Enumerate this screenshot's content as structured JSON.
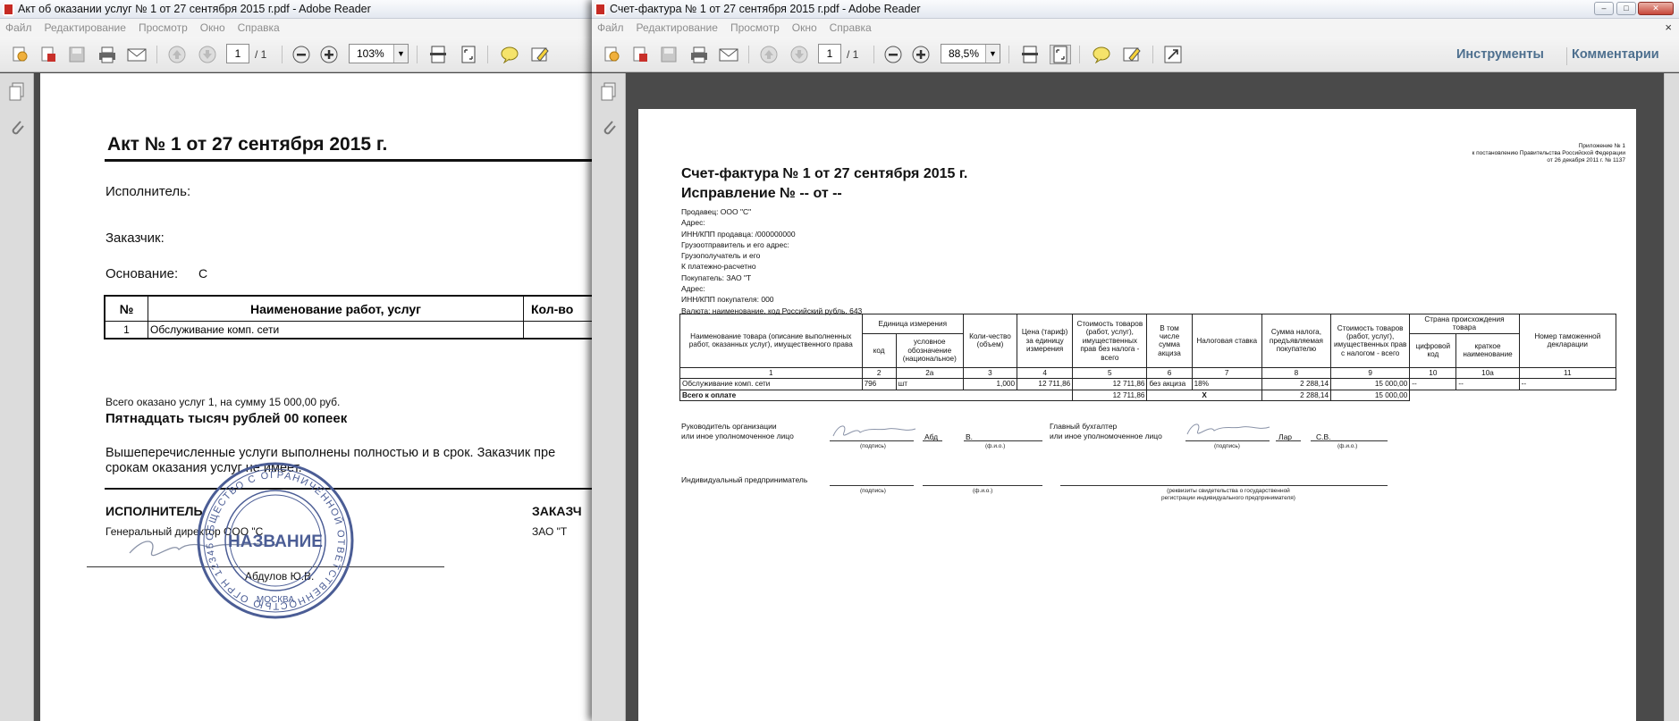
{
  "left_window": {
    "title": "Акт об оказании услуг № 1 от 27 сентября 2015 г.pdf - Adobe Reader",
    "menu": [
      "Файл",
      "Редактирование",
      "Просмотр",
      "Окно",
      "Справка"
    ],
    "page_num": "1",
    "page_total": "/ 1",
    "zoom": "103%",
    "doc": {
      "title": "Акт № 1 от 27 сентября 2015 г.",
      "executor_label": "Исполнитель:",
      "customer_label": "Заказчик:",
      "basis_label": "Основание:",
      "basis_value": "С",
      "table_headers": [
        "№",
        "Наименование работ, услуг",
        "Кол-во"
      ],
      "table_row": [
        "1",
        "Обслуживание комп. сети"
      ],
      "total_line": "Всего оказано услуг 1, на сумму 15 000,00 руб.",
      "total_words": "Пятнадцать тысяч рублей 00 копеек",
      "note_line1": "Вышеперечисленные услуги выполнены полностью и в срок. Заказчик пре",
      "note_line2": "срокам оказания услуг не имеет.",
      "executor_heading": "ИСПОЛНИТЕЛЬ",
      "customer_heading": "ЗАКАЗЧ",
      "director": "Генеральный директор ООО \"С",
      "customer_org": "ЗАО \"Т",
      "signer": "Абдулов Ю.В.",
      "stamp_center": "НАЗВАНИЕ",
      "stamp_bottom": "МОСКВА",
      "stamp_ring": "ОБЩЕСТВО С ОГРАНИЧЕННОЙ ОТВЕТСТВЕННОСТЬЮ ОГРН 12345"
    }
  },
  "right_window": {
    "title": "Счет-фактура № 1 от 27 сентября 2015 г.pdf - Adobe Reader",
    "menu": [
      "Файл",
      "Редактирование",
      "Просмотр",
      "Окно",
      "Справка"
    ],
    "page_num": "1",
    "page_total": "/ 1",
    "zoom": "88,5%",
    "tools_label": "Инструменты",
    "comments_label": "Комментарии",
    "doc": {
      "appendix1": "Приложение № 1",
      "appendix2": "к постановлению Правительства Российской Федерации",
      "appendix3": "от 26 декабря 2011 г. № 1137",
      "title": "Счет-фактура № 1 от 27 сентября 2015 г.",
      "correction": "Исправление № -- от --",
      "fields": [
        "Продавец: ООО \"С\"",
        "Адрес:",
        "ИНН/КПП продавца: /000000000",
        "Грузоотправитель и его адрес:",
        "Грузополучатель и его",
        "К платежно-расчетно",
        "Покупатель: ЗАО \"Т",
        "Адрес:",
        "ИНН/КПП покупателя: 000",
        "Валюта: наименование, код Российский рубль, 643"
      ],
      "headers": {
        "name": "Наименование товара (описание выполненных работ, оказанных услуг), имущественного права",
        "unit": "Единица измерения",
        "unit_code": "код",
        "unit_name": "условное обозначение (национальное)",
        "qty": "Коли-чество (объем)",
        "price": "Цена (тариф) за единицу измерения",
        "cost": "Стоимость товаров (работ, услуг), имущественных прав без налога - всего",
        "excise": "В том числе сумма акциза",
        "rate": "Налоговая ставка",
        "tax": "Сумма налога, предъявляемая покупателю",
        "total": "Стоимость товаров (работ, услуг), имущественных прав с налогом - всего",
        "country": "Страна происхождения товара",
        "country_code": "цифровой код",
        "country_name": "краткое наименование",
        "customs": "Номер таможенной декларации"
      },
      "col_nums": [
        "1",
        "2",
        "2а",
        "3",
        "4",
        "5",
        "6",
        "7",
        "8",
        "9",
        "10",
        "10а",
        "11"
      ],
      "row": [
        "Обслуживание комп. сети",
        "796",
        "шт",
        "1,000",
        "12 711,86",
        "12 711,86",
        "без акциза",
        "18%",
        "2 288,14",
        "15 000,00",
        "--",
        "--",
        "--"
      ],
      "total_row": {
        "label": "Всего к оплате",
        "cost": "12 711,86",
        "x": "X",
        "tax": "2 288,14",
        "total": "15 000,00"
      },
      "head_label": "Руководитель организации",
      "head_label2": "или иное уполномоченное лицо",
      "head_name1": "Абд",
      "head_name2": "В.",
      "acc_label": "Главный бухгалтер",
      "acc_label2": "или иное уполномоченное лицо",
      "acc_name1": "Лар",
      "acc_name2": "С.В.",
      "sign_cap": "(подпись)",
      "fio_cap": "(ф.и.о.)",
      "ip_label": "Индивидуальный предприниматель",
      "reg_cap1": "(реквизиты свидетельства о государственной",
      "reg_cap2": "регистрации индивидуального предпринимателя)"
    }
  }
}
